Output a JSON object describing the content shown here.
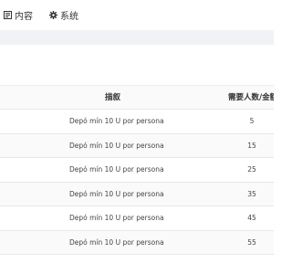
{
  "nav": {
    "items": [
      {
        "label": "内容",
        "icon": "content-icon"
      },
      {
        "label": "系统",
        "icon": "gear-icon"
      }
    ]
  },
  "table": {
    "headers": {
      "description": "描叙",
      "required": "需要人数/金额"
    },
    "rows": [
      {
        "description": "Depó mín 10 U por persona",
        "required": "5"
      },
      {
        "description": "Depó mín 10 U por persona",
        "required": "15"
      },
      {
        "description": "Depó mín 10 U por persona",
        "required": "25"
      },
      {
        "description": "Depó mín 10 U por persona",
        "required": "35"
      },
      {
        "description": "Depó mín 10 U por persona",
        "required": "45"
      },
      {
        "description": "Depó mín 10 U por persona",
        "required": "55"
      }
    ]
  }
}
